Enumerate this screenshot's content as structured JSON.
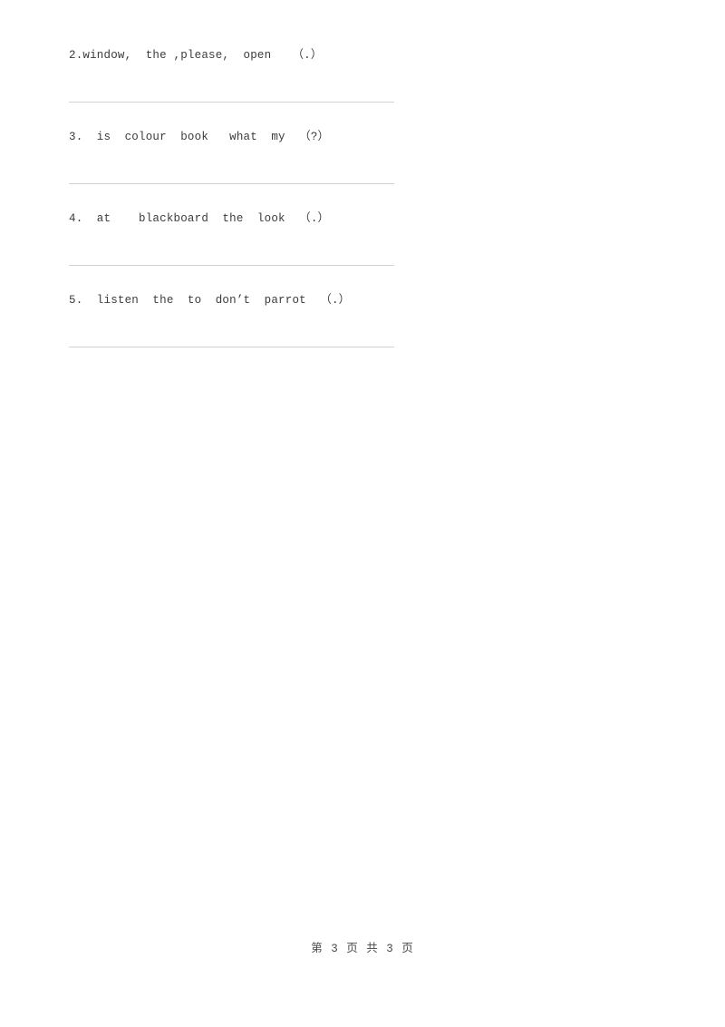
{
  "document": {
    "page_background": "#ffffff",
    "text_color": "#3c3c3c",
    "rule_color": "#d2d2d2",
    "footer_color": "#4a4a4a"
  },
  "questions": [
    {
      "text": "2.window,  the ,please,  open   （.）"
    },
    {
      "text": "3.  is  colour  book   what  my  （?）"
    },
    {
      "text": "4.  at    blackboard  the  look  （.）"
    },
    {
      "text": "5.  listen  the  to  don’t  parrot  （.）"
    }
  ],
  "footer": {
    "text": "第 3 页 共 3 页",
    "current_page": "3",
    "total_pages": "3"
  }
}
